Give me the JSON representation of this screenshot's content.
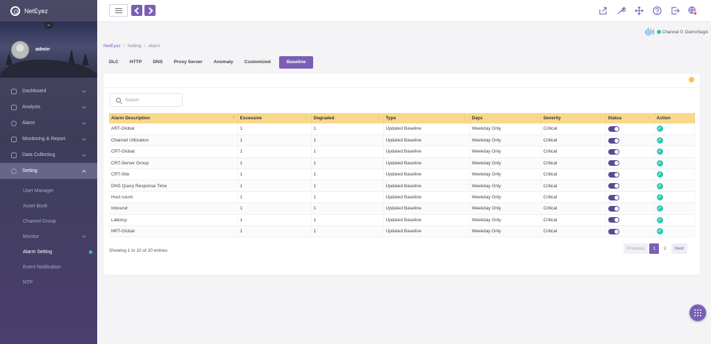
{
  "app": {
    "brand": "NetEyez"
  },
  "user": {
    "name": "admin"
  },
  "sidebar": {
    "items": [
      {
        "label": "Dashboard"
      },
      {
        "label": "Analysis"
      },
      {
        "label": "Alarm"
      },
      {
        "label": "Monitoring & Report"
      },
      {
        "label": "Data Collecting"
      },
      {
        "label": "Setting"
      }
    ],
    "sub_items": [
      {
        "label": "User Manager"
      },
      {
        "label": "Asset Book"
      },
      {
        "label": "Channel Group"
      },
      {
        "label": "Monitor"
      },
      {
        "label": "Alarm Setting"
      },
      {
        "label": "Event Notification"
      },
      {
        "label": "NTP"
      }
    ]
  },
  "channel": {
    "label": "Channel 0: DemoSegA"
  },
  "breadcrumb": {
    "home": "NetEyez",
    "level2": "Setting",
    "level3": "Alarm"
  },
  "tabs": [
    {
      "label": "DLC"
    },
    {
      "label": "HTTP"
    },
    {
      "label": "DNS"
    },
    {
      "label": "Proxy Server"
    },
    {
      "label": "Anomaly"
    },
    {
      "label": "Customized"
    },
    {
      "label": "Baseline"
    }
  ],
  "search": {
    "placeholder": "Search"
  },
  "table": {
    "headers": [
      "Alarm Description",
      "Excessive",
      "Degraded",
      "Type",
      "Days",
      "Severity",
      "Status",
      "Action"
    ],
    "rows": [
      [
        "ART-Global",
        "1",
        "1",
        "Updated Baseline",
        "Weekday Only",
        "Critical"
      ],
      [
        "Channel Utilization",
        "1",
        "1",
        "Updated Baseline",
        "Weekday Only",
        "Critical"
      ],
      [
        "CRT-Global",
        "1",
        "1",
        "Updated Baseline",
        "Weekday Only",
        "Critical"
      ],
      [
        "CRT-Server Group",
        "1",
        "1",
        "Updated Baseline",
        "Weekday Only",
        "Critical"
      ],
      [
        "CRT-Site",
        "1",
        "1",
        "Updated Baseline",
        "Weekday Only",
        "Critical"
      ],
      [
        "DNS Query Response Time",
        "1",
        "1",
        "Updated Baseline",
        "Weekday Only",
        "Critical"
      ],
      [
        "Host count",
        "1",
        "1",
        "Updated Baseline",
        "Weekday Only",
        "Critical"
      ],
      [
        "Inbound",
        "1",
        "1",
        "Updated Baseline",
        "Weekday Only",
        "Critical"
      ],
      [
        "Latency",
        "1",
        "1",
        "Updated Baseline",
        "Weekday Only",
        "Critical"
      ],
      [
        "NRT-Global",
        "1",
        "1",
        "Updated Baseline",
        "Weekday Only",
        "Critical"
      ]
    ]
  },
  "footer": {
    "info": "Showing 1 to 10 of 20 entries"
  },
  "pagination": {
    "previous": "Previous",
    "pages": [
      "1",
      "2"
    ],
    "next": "Next"
  },
  "colors": {
    "accent": "#7b5fb5",
    "header_bg": "#f8d88a",
    "status_ok": "#25c9b0",
    "indicator": "#f8c74b"
  },
  "icons": {
    "topbar": [
      "share-icon",
      "wrench-icon",
      "move-icon",
      "help-icon",
      "logout-icon",
      "globe-user-icon"
    ]
  }
}
